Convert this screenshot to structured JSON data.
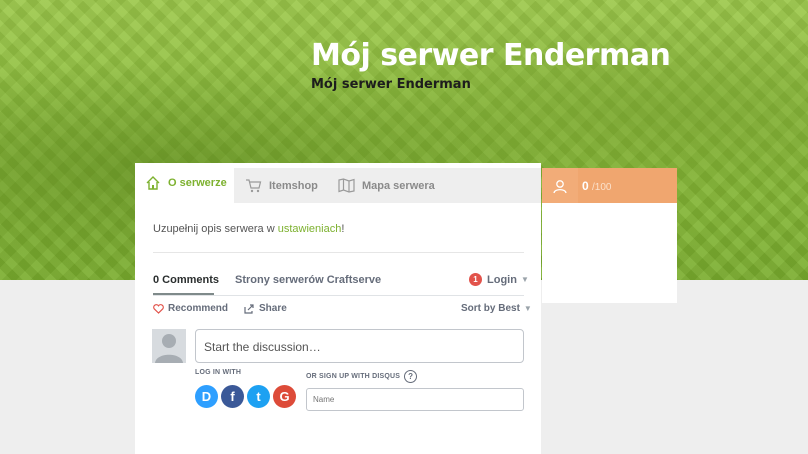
{
  "hero": {
    "title": "Mój serwer Enderman",
    "subtitle": "Mój serwer Enderman"
  },
  "tabs": [
    {
      "label": "O serwerze",
      "icon": "home-icon",
      "active": true
    },
    {
      "label": "Itemshop",
      "icon": "cart-icon",
      "active": false
    },
    {
      "label": "Mapa serwera",
      "icon": "map-icon",
      "active": false
    }
  ],
  "description": {
    "prefix": "Uzupełnij opis serwera w ",
    "link": "ustawieniach",
    "suffix": "!"
  },
  "players": {
    "current": "0",
    "max": "/100"
  },
  "disqus": {
    "comments_tab": "0 Comments",
    "community": "Strony serwerów Craftserve",
    "login_badge": "1",
    "login": "Login",
    "recommend": "Recommend",
    "share": "Share",
    "sort": "Sort by Best",
    "compose_placeholder": "Start the discussion…",
    "login_with": "LOG IN WITH",
    "signup": "OR SIGN UP WITH DISQUS",
    "help": "?",
    "name_placeholder": "Name",
    "social": [
      {
        "letter": "D",
        "name": "disqus",
        "color": "#2e9fff"
      },
      {
        "letter": "f",
        "name": "facebook",
        "color": "#3b5998"
      },
      {
        "letter": "t",
        "name": "twitter",
        "color": "#1da1f2"
      },
      {
        "letter": "G",
        "name": "google",
        "color": "#dd4b39"
      }
    ]
  },
  "colors": {
    "accent": "#7db12f",
    "players": "#f0a66f"
  }
}
